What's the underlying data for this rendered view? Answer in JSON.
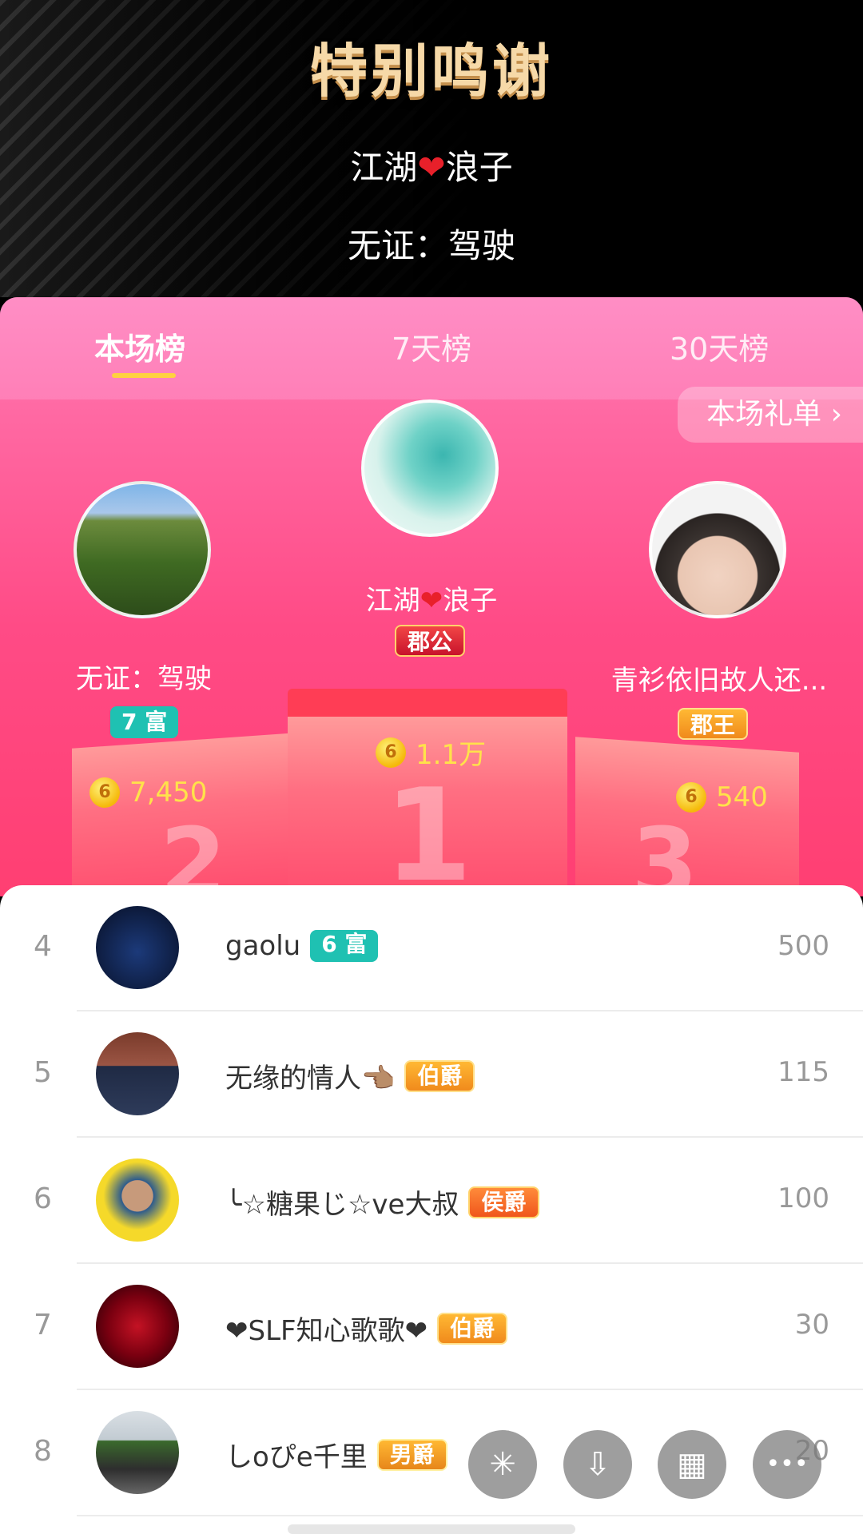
{
  "header": {
    "title": "特别鸣谢",
    "line1_left": "江湖",
    "line1_right": "浪子",
    "line2": "无证：驾驶"
  },
  "tabs": [
    {
      "label": "本场榜",
      "active": true
    },
    {
      "label": "7天榜",
      "active": false
    },
    {
      "label": "30天榜",
      "active": false
    }
  ],
  "gift_list_link": "本场礼单 ›",
  "podium": {
    "first": {
      "name_left": "江湖",
      "name_right": "浪子",
      "badge": "郡公",
      "coins": "1.1万",
      "place": "1"
    },
    "second": {
      "name": "无证：驾驶",
      "badge": "7 富",
      "coins": "7,450",
      "place": "2"
    },
    "third": {
      "name": "青衫依旧故人还...",
      "badge": "郡王",
      "coins": "540",
      "place": "3"
    }
  },
  "coin_symbol": "6",
  "list": [
    {
      "rank": "4",
      "name": "gaolu",
      "badge": "6 富",
      "badge_style": "teal",
      "score": "500"
    },
    {
      "rank": "5",
      "name": "无缘的情人👈🏽",
      "badge": "伯爵",
      "badge_style": "gold",
      "score": "115"
    },
    {
      "rank": "6",
      "name": "╰☆糖果じ☆ve大叔",
      "badge": "侯爵",
      "badge_style": "orange",
      "score": "100"
    },
    {
      "rank": "7",
      "name": "❤SLF知心歌歌❤",
      "badge": "伯爵",
      "badge_style": "gold",
      "score": "30"
    },
    {
      "rank": "8",
      "name": "しoぴe千里",
      "badge": "男爵",
      "badge_style": "gold2",
      "score": "20"
    }
  ],
  "fabs": [
    {
      "icon": "sparkle-icon",
      "glyph": "✳"
    },
    {
      "icon": "download-icon",
      "glyph": "⇩"
    },
    {
      "icon": "grid-icon",
      "glyph": "▦"
    },
    {
      "icon": "more-icon",
      "glyph": "•••"
    }
  ],
  "colors": {
    "accent_pink": "#ff4b86",
    "tab_underline": "#ffd140",
    "coin_yellow": "#ffe24a",
    "badge_teal": "#1fc1b2"
  }
}
